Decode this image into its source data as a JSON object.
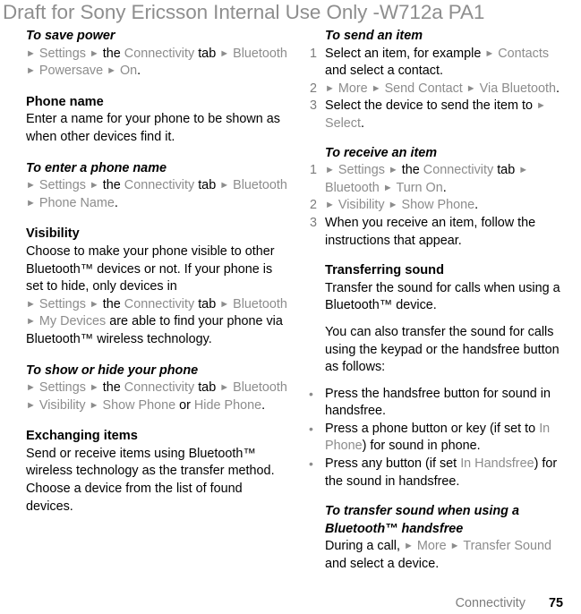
{
  "watermark": "Draft for Sony Ericsson Internal Use Only -W712a PA1",
  "colors": {
    "menu_path_gray": "#8c8c8c",
    "watermark_gray": "#8e8e8e",
    "list_number_gray": "#7d7d7d",
    "body_black": "#000000"
  },
  "left_column": {
    "save_power": {
      "heading": "To save power",
      "path": {
        "t1": "►",
        "settings": "Settings",
        "t2": "►",
        "the": "the",
        "connectivity": "Connectivity",
        "tab": "tab",
        "t3": "►",
        "bluetooth": "Bluetooth",
        "t4": "►",
        "powersave": "Powersave",
        "t5": "►",
        "on": "On",
        "period": "."
      }
    },
    "phone_name": {
      "heading": "Phone name",
      "body": "Enter a name for your phone to be shown as when other devices find it."
    },
    "enter_phone_name": {
      "heading": "To enter a phone name",
      "path": {
        "t1": "►",
        "settings": "Settings",
        "t2": "►",
        "the": "the",
        "connectivity": "Connectivity",
        "tab": "tab",
        "t3": "►",
        "bluetooth": "Bluetooth",
        "t4": "►",
        "phone_name": "Phone Name",
        "period": "."
      }
    },
    "visibility": {
      "heading": "Visibility",
      "body_part1": "Choose to make your phone visible to other Bluetooth™ devices or not. If your phone is set to hide, only devices in",
      "path": {
        "t1": "►",
        "settings": "Settings",
        "t2": "►",
        "the": "the",
        "connectivity": "Connectivity",
        "tab": "tab",
        "t3": "►",
        "bluetooth": "Bluetooth",
        "t4": "►",
        "my_devices": "My Devices"
      },
      "body_part2": "are able to find your phone via Bluetooth™ wireless technology."
    },
    "show_hide_phone": {
      "heading": "To show or hide your phone",
      "path": {
        "t1": "►",
        "settings": "Settings",
        "t2": "►",
        "the": "the",
        "connectivity": "Connectivity",
        "tab": "tab",
        "t3": "►",
        "bluetooth": "Bluetooth",
        "t4": "►",
        "visibility": "Visibility",
        "t5": "►",
        "show_phone": "Show Phone",
        "or": "or",
        "hide_phone": "Hide Phone",
        "period": "."
      }
    },
    "exchanging_items": {
      "heading": "Exchanging items",
      "body": "Send or receive items using Bluetooth™ wireless technology as the transfer method. Choose a device from the list of found devices."
    }
  },
  "right_column": {
    "send_item": {
      "heading": "To send an item",
      "steps": [
        {
          "num": "1",
          "pre": "Select an item, for example",
          "t1": "►",
          "target": "Contacts",
          "post": "and select a contact."
        },
        {
          "num": "2",
          "t1": "►",
          "more": "More",
          "t2": "►",
          "send_contact": "Send Contact",
          "t3": "►",
          "via_bluetooth": "Via Bluetooth",
          "period": "."
        },
        {
          "num": "3",
          "pre": "Select the device to send the item to",
          "t1": "►",
          "target": "Select",
          "period": "."
        }
      ]
    },
    "receive_item": {
      "heading": "To receive an item",
      "steps": [
        {
          "num": "1",
          "t1": "►",
          "settings": "Settings",
          "t2": "►",
          "the": "the",
          "connectivity": "Connectivity",
          "tab": "tab",
          "t3": "►",
          "bluetooth": "Bluetooth",
          "t4": "►",
          "turn_on": "Turn On",
          "period": "."
        },
        {
          "num": "2",
          "t1": "►",
          "visibility": "Visibility",
          "t2": "►",
          "show_phone": "Show Phone",
          "period": "."
        },
        {
          "num": "3",
          "text": "When you receive an item, follow the instructions that appear."
        }
      ]
    },
    "transferring_sound": {
      "heading": "Transferring sound",
      "body1": "Transfer the sound for calls when using a Bluetooth™ device.",
      "body2": "You can also transfer the sound for calls using the keypad or the handsfree button as follows:"
    },
    "sound_bullets": {
      "dot": "•",
      "items": [
        {
          "pre": "Press the handsfree button for sound in handsfree.",
          "highlight": "",
          "post": ""
        },
        {
          "pre": "Press a phone button or key (if set to",
          "highlight": "In Phone",
          "post": ") for sound in phone."
        },
        {
          "pre": "Press any button (if set",
          "highlight": "In Handsfree",
          "post": ") for the sound in handsfree."
        }
      ]
    },
    "transfer_sound_handsfree": {
      "heading": "To transfer sound when using a Bluetooth™ handsfree",
      "pre": "During a call,",
      "t1": "►",
      "more": "More",
      "t2": "►",
      "transfer_sound": "Transfer Sound",
      "post": "and select a device."
    }
  },
  "footer": {
    "chapter": "Connectivity",
    "page": "75"
  }
}
